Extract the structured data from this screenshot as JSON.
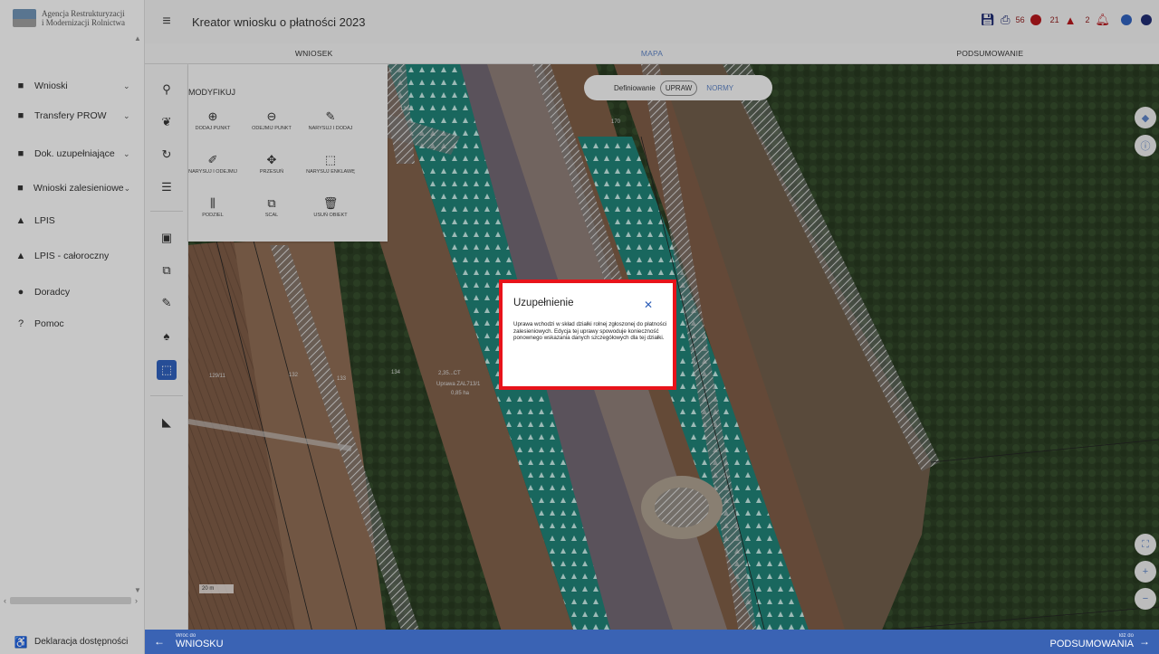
{
  "header": {
    "logo_line1": "Agencja Restrukturyzacji",
    "logo_line2": "i Modernizacji Rolnictwa",
    "title": "Kreator wniosku o płatności 2023",
    "counts": {
      "errors": "56",
      "warnings": "21",
      "notifications": "2"
    }
  },
  "tabs": [
    {
      "label": "WNIOSEK"
    },
    {
      "label": "MAPA"
    },
    {
      "label": "PODSUMOWANIE"
    }
  ],
  "sidebar": {
    "items": [
      {
        "label": "Wnioski",
        "icon": "folder-icon"
      },
      {
        "label": "Transfery PROW",
        "icon": "folder-icon"
      },
      {
        "label": "Dok. uzupełniające",
        "icon": "folder-icon"
      },
      {
        "label": "Wnioski zalesieniowe",
        "icon": "folder-icon"
      },
      {
        "label": "LPIS",
        "icon": "mountain-icon"
      },
      {
        "label": "LPIS - całoroczny",
        "icon": "mountain-icon"
      },
      {
        "label": "Doradcy",
        "icon": "person-icon"
      },
      {
        "label": "Pomoc",
        "icon": "help-icon"
      }
    ],
    "accessibility": "Deklaracja dostępności"
  },
  "modify_panel": {
    "title": "MODYFIKUJ",
    "tools": [
      {
        "label": "DODAJ PUNKT",
        "glyph": "⊕"
      },
      {
        "label": "ODEJMIJ PUNKT",
        "glyph": "⊖"
      },
      {
        "label": "NARYSUJ I DODAJ",
        "glyph": "✎"
      },
      {
        "label": "NARYSUJ I ODEJMIJ",
        "glyph": "✐"
      },
      {
        "label": "PRZESUŃ",
        "glyph": "✥"
      },
      {
        "label": "NARYSUJ ENKLAWĘ",
        "glyph": "⬚"
      },
      {
        "label": "PODZIEL",
        "glyph": "⫼"
      },
      {
        "label": "SCAL",
        "glyph": "⧉"
      },
      {
        "label": "USUŃ OBIEKT",
        "glyph": "🗑"
      }
    ]
  },
  "map": {
    "toggle_label": "Definiowanie",
    "toggle_options": [
      "UPRAW",
      "NORMY"
    ],
    "parcel_labels": [
      "136/1",
      "170",
      "129/11",
      "132",
      "133",
      "134"
    ],
    "crop_label_line1": "Uprawa ZAL713/1",
    "crop_label_line2": "0,85 ha",
    "crop_id_fragment": "2,35...CT",
    "scale": "20 m"
  },
  "dialog": {
    "title": "Uzupełnienie",
    "body": "Uprawa wchodzi w skład działki rolnej zgłoszonej do płatności zalesieniowych. Edycja tej uprawy spowoduje konieczność ponownego wskazania danych szczegółowych dla tej działki."
  },
  "footer": {
    "back_small": "Wróć do",
    "back_big": "WNIOSKU",
    "next_small": "Idź do",
    "next_big": "PODSUMOWANIA"
  }
}
